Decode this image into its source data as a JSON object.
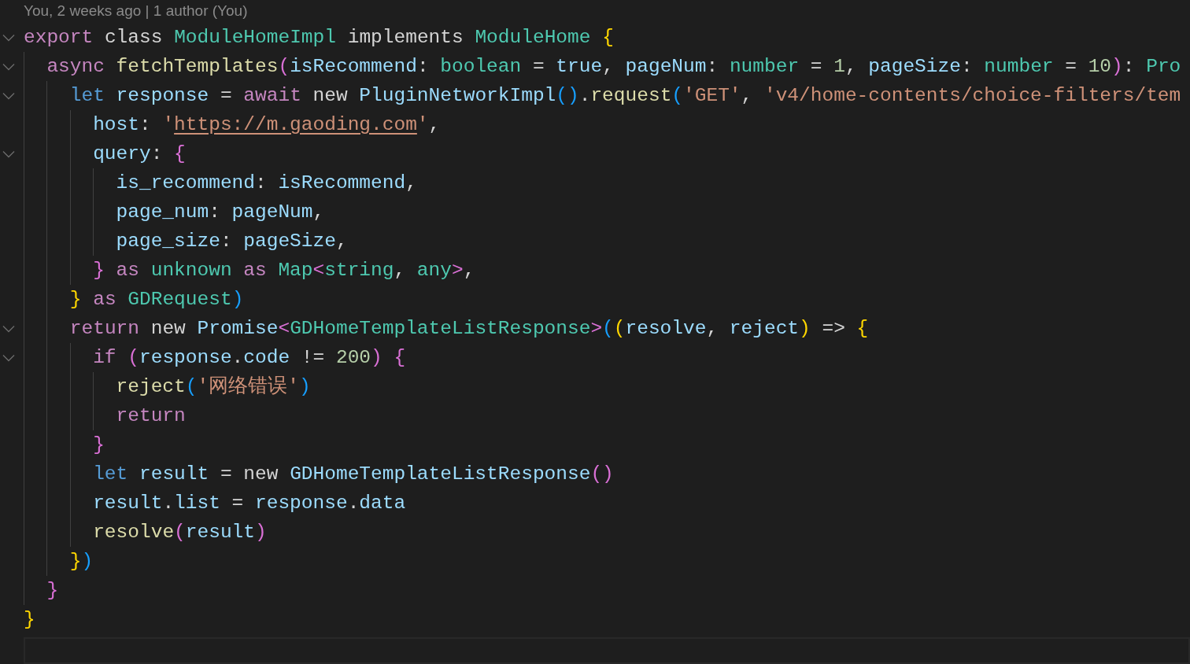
{
  "blame": "You, 2 weeks ago | 1 author (You)",
  "lines": [
    {
      "foldable": true,
      "tokens": [
        {
          "kind": "keyword",
          "text": "export"
        },
        {
          "kind": "plain",
          "text": " class "
        },
        {
          "kind": "type",
          "text": "ModuleHomeImpl"
        },
        {
          "kind": "plain",
          "text": " implements "
        },
        {
          "kind": "type",
          "text": "ModuleHome"
        },
        {
          "kind": "bracket1",
          "text": " {"
        }
      ],
      "children": [
        {
          "foldable": true,
          "tokens": [
            {
              "kind": "keyword",
              "text": "async "
            },
            {
              "kind": "function",
              "text": "fetchTemplates"
            },
            {
              "kind": "bracket2",
              "text": "("
            },
            {
              "kind": "variable",
              "text": "isRecommend"
            },
            {
              "kind": "plain",
              "text": ": "
            },
            {
              "kind": "type",
              "text": "boolean"
            },
            {
              "kind": "plain",
              "text": " = "
            },
            {
              "kind": "variable",
              "text": "true"
            },
            {
              "kind": "plain",
              "text": ", "
            },
            {
              "kind": "variable",
              "text": "pageNum"
            },
            {
              "kind": "plain",
              "text": ": "
            },
            {
              "kind": "type",
              "text": "number"
            },
            {
              "kind": "plain",
              "text": " = "
            },
            {
              "kind": "number",
              "text": "1"
            },
            {
              "kind": "plain",
              "text": ", "
            },
            {
              "kind": "variable",
              "text": "pageSize"
            },
            {
              "kind": "plain",
              "text": ": "
            },
            {
              "kind": "type",
              "text": "number"
            },
            {
              "kind": "plain",
              "text": " = "
            },
            {
              "kind": "number",
              "text": "10"
            },
            {
              "kind": "bracket2",
              "text": ")"
            },
            {
              "kind": "plain",
              "text": ": "
            },
            {
              "kind": "type",
              "text": "Pro"
            }
          ],
          "children": [
            {
              "foldable": true,
              "tokens": [
                {
                  "kind": "storage",
                  "text": "let "
                },
                {
                  "kind": "variable",
                  "text": "response"
                },
                {
                  "kind": "plain",
                  "text": " = "
                },
                {
                  "kind": "keyword",
                  "text": "await"
                },
                {
                  "kind": "plain",
                  "text": " new "
                },
                {
                  "kind": "variable",
                  "text": "PluginNetworkImpl"
                },
                {
                  "kind": "bracket3",
                  "text": "()"
                },
                {
                  "kind": "plain",
                  "text": "."
                },
                {
                  "kind": "function",
                  "text": "request"
                },
                {
                  "kind": "bracket3",
                  "text": "("
                },
                {
                  "kind": "string",
                  "text": "'GET'"
                },
                {
                  "kind": "plain",
                  "text": ", "
                },
                {
                  "kind": "string",
                  "text": "'v4/home-contents/choice-filters/tem"
                }
              ],
              "children": [
                {
                  "foldable": false,
                  "tokens": [
                    {
                      "kind": "variable",
                      "text": "host"
                    },
                    {
                      "kind": "plain",
                      "text": ": "
                    },
                    {
                      "kind": "string",
                      "text": "'"
                    },
                    {
                      "kind": "link",
                      "text": "https://m.gaoding.com"
                    },
                    {
                      "kind": "string",
                      "text": "'"
                    },
                    {
                      "kind": "plain",
                      "text": ","
                    }
                  ]
                },
                {
                  "foldable": true,
                  "tokens": [
                    {
                      "kind": "variable",
                      "text": "query"
                    },
                    {
                      "kind": "plain",
                      "text": ": "
                    },
                    {
                      "kind": "bracket2",
                      "text": "{"
                    }
                  ],
                  "children": [
                    {
                      "foldable": false,
                      "tokens": [
                        {
                          "kind": "variable",
                          "text": "is_recommend"
                        },
                        {
                          "kind": "plain",
                          "text": ": "
                        },
                        {
                          "kind": "variable",
                          "text": "isRecommend"
                        },
                        {
                          "kind": "plain",
                          "text": ","
                        }
                      ]
                    },
                    {
                      "foldable": false,
                      "tokens": [
                        {
                          "kind": "variable",
                          "text": "page_num"
                        },
                        {
                          "kind": "plain",
                          "text": ": "
                        },
                        {
                          "kind": "variable",
                          "text": "pageNum"
                        },
                        {
                          "kind": "plain",
                          "text": ","
                        }
                      ]
                    },
                    {
                      "foldable": false,
                      "tokens": [
                        {
                          "kind": "variable",
                          "text": "page_size"
                        },
                        {
                          "kind": "plain",
                          "text": ": "
                        },
                        {
                          "kind": "variable",
                          "text": "pageSize"
                        },
                        {
                          "kind": "plain",
                          "text": ","
                        }
                      ]
                    }
                  ]
                },
                {
                  "foldable": false,
                  "tokens": [
                    {
                      "kind": "bracket2",
                      "text": "}"
                    },
                    {
                      "kind": "keyword",
                      "text": " as "
                    },
                    {
                      "kind": "type",
                      "text": "unknown"
                    },
                    {
                      "kind": "keyword",
                      "text": " as "
                    },
                    {
                      "kind": "type",
                      "text": "Map"
                    },
                    {
                      "kind": "bracket2",
                      "text": "<"
                    },
                    {
                      "kind": "type",
                      "text": "string"
                    },
                    {
                      "kind": "plain",
                      "text": ", "
                    },
                    {
                      "kind": "type",
                      "text": "any"
                    },
                    {
                      "kind": "bracket2",
                      "text": ">"
                    },
                    {
                      "kind": "plain",
                      "text": ","
                    }
                  ]
                }
              ]
            },
            {
              "foldable": false,
              "tokens": [
                {
                  "kind": "bracket1",
                  "text": "}"
                },
                {
                  "kind": "keyword",
                  "text": " as "
                },
                {
                  "kind": "type",
                  "text": "GDRequest"
                },
                {
                  "kind": "bracket3",
                  "text": ")"
                }
              ]
            },
            {
              "foldable": true,
              "tokens": [
                {
                  "kind": "keyword",
                  "text": "return"
                },
                {
                  "kind": "plain",
                  "text": " new "
                },
                {
                  "kind": "variable",
                  "text": "Promise"
                },
                {
                  "kind": "bracket2",
                  "text": "<"
                },
                {
                  "kind": "type",
                  "text": "GDHomeTemplateListResponse"
                },
                {
                  "kind": "bracket2",
                  "text": ">"
                },
                {
                  "kind": "bracket3",
                  "text": "("
                },
                {
                  "kind": "bracket1",
                  "text": "("
                },
                {
                  "kind": "variable",
                  "text": "resolve"
                },
                {
                  "kind": "plain",
                  "text": ", "
                },
                {
                  "kind": "variable",
                  "text": "reject"
                },
                {
                  "kind": "bracket1",
                  "text": ")"
                },
                {
                  "kind": "plain",
                  "text": " => "
                },
                {
                  "kind": "bracket1",
                  "text": "{"
                }
              ],
              "children": [
                {
                  "foldable": true,
                  "tokens": [
                    {
                      "kind": "keyword",
                      "text": "if "
                    },
                    {
                      "kind": "bracket2",
                      "text": "("
                    },
                    {
                      "kind": "variable",
                      "text": "response"
                    },
                    {
                      "kind": "plain",
                      "text": "."
                    },
                    {
                      "kind": "variable",
                      "text": "code"
                    },
                    {
                      "kind": "plain",
                      "text": " != "
                    },
                    {
                      "kind": "number",
                      "text": "200"
                    },
                    {
                      "kind": "bracket2",
                      "text": ")"
                    },
                    {
                      "kind": "bracket2",
                      "text": " {"
                    }
                  ],
                  "children": [
                    {
                      "foldable": false,
                      "tokens": [
                        {
                          "kind": "function",
                          "text": "reject"
                        },
                        {
                          "kind": "bracket3",
                          "text": "("
                        },
                        {
                          "kind": "string",
                          "text": "'网络错误'"
                        },
                        {
                          "kind": "bracket3",
                          "text": ")"
                        }
                      ]
                    },
                    {
                      "foldable": false,
                      "tokens": [
                        {
                          "kind": "keyword",
                          "text": "return"
                        }
                      ]
                    }
                  ]
                },
                {
                  "foldable": false,
                  "tokens": [
                    {
                      "kind": "bracket2",
                      "text": "}"
                    }
                  ]
                },
                {
                  "foldable": false,
                  "tokens": [
                    {
                      "kind": "storage",
                      "text": "let "
                    },
                    {
                      "kind": "variable",
                      "text": "result"
                    },
                    {
                      "kind": "plain",
                      "text": " = new "
                    },
                    {
                      "kind": "variable",
                      "text": "GDHomeTemplateListResponse"
                    },
                    {
                      "kind": "bracket2",
                      "text": "()"
                    }
                  ]
                },
                {
                  "foldable": false,
                  "tokens": [
                    {
                      "kind": "variable",
                      "text": "result"
                    },
                    {
                      "kind": "plain",
                      "text": "."
                    },
                    {
                      "kind": "variable",
                      "text": "list"
                    },
                    {
                      "kind": "plain",
                      "text": " = "
                    },
                    {
                      "kind": "variable",
                      "text": "response"
                    },
                    {
                      "kind": "plain",
                      "text": "."
                    },
                    {
                      "kind": "variable",
                      "text": "data"
                    }
                  ]
                },
                {
                  "foldable": false,
                  "tokens": [
                    {
                      "kind": "function",
                      "text": "resolve"
                    },
                    {
                      "kind": "bracket2",
                      "text": "("
                    },
                    {
                      "kind": "variable",
                      "text": "result"
                    },
                    {
                      "kind": "bracket2",
                      "text": ")"
                    }
                  ]
                }
              ]
            },
            {
              "foldable": false,
              "tokens": [
                {
                  "kind": "bracket1",
                  "text": "}"
                },
                {
                  "kind": "bracket3",
                  "text": ")"
                }
              ]
            }
          ]
        },
        {
          "foldable": false,
          "tokens": [
            {
              "kind": "bracket2",
              "text": "}"
            }
          ]
        }
      ]
    },
    {
      "foldable": false,
      "tokens": [
        {
          "kind": "bracket1",
          "text": "}"
        }
      ]
    }
  ]
}
